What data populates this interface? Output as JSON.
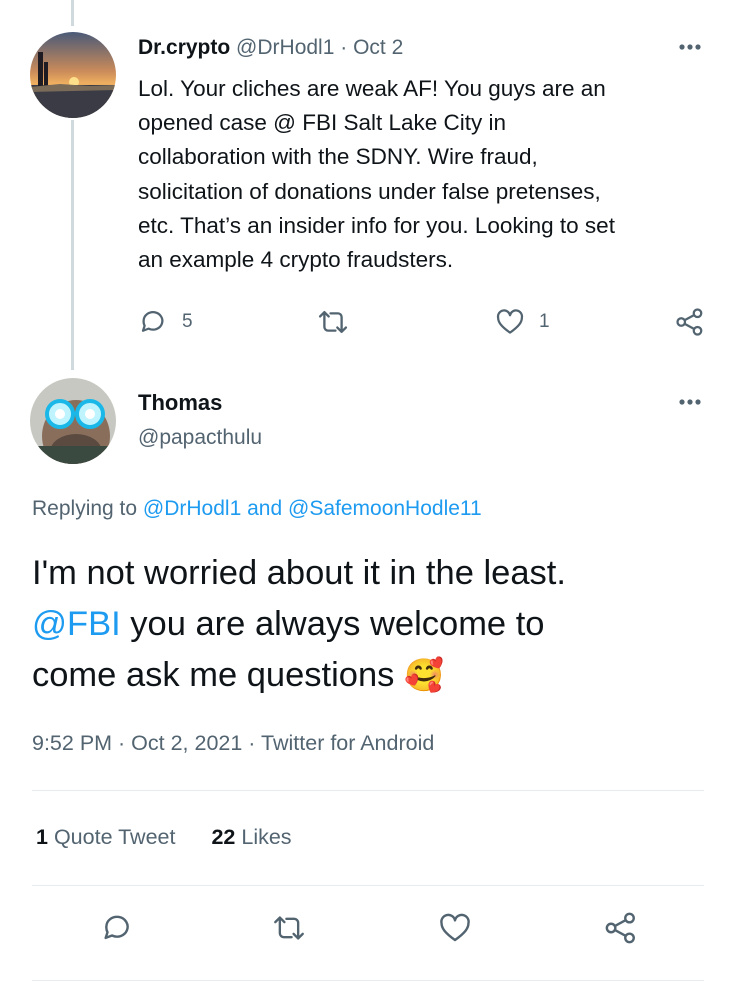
{
  "tweet1": {
    "display_name": "Dr.crypto",
    "handle": "@DrHodl1",
    "date": "· Oct 2",
    "lines": [
      "Lol. Your cliches are weak AF! You guys are an",
      "opened case @ FBI Salt Lake City in",
      "collaboration with the SDNY. Wire fraud,",
      "solicitation of donations under false pretenses,",
      "etc. That’s an insider info for you. Looking to set",
      "an example 4 crypto fraudsters."
    ],
    "reply_count": "5",
    "like_count": "1"
  },
  "tweet2": {
    "display_name": "Thomas",
    "handle": "@papacthulu",
    "replying_prefix": "Replying to",
    "replying_user1": "@DrHodl1",
    "replying_and": "and",
    "replying_user2": "@SafemoonHodle11",
    "line1": "I'm not worried about it in the least.",
    "mention": "@FBI",
    "line2_rest": " you are always welcome to",
    "line3": "come ask me questions",
    "emoji": "🥰",
    "meta": "9:52 PM · Oct 2, 2021 · Twitter for Android",
    "quote_count": "1",
    "quote_label": "Quote Tweet",
    "like_count": "22",
    "like_label": "Likes"
  },
  "colors": {
    "accent": "#1d9bf0",
    "text": "#0f1419",
    "muted": "#536471",
    "divider": "#e6ecf0"
  },
  "icons": [
    "more-icon",
    "reply-icon",
    "retweet-icon",
    "like-icon",
    "share-icon"
  ]
}
